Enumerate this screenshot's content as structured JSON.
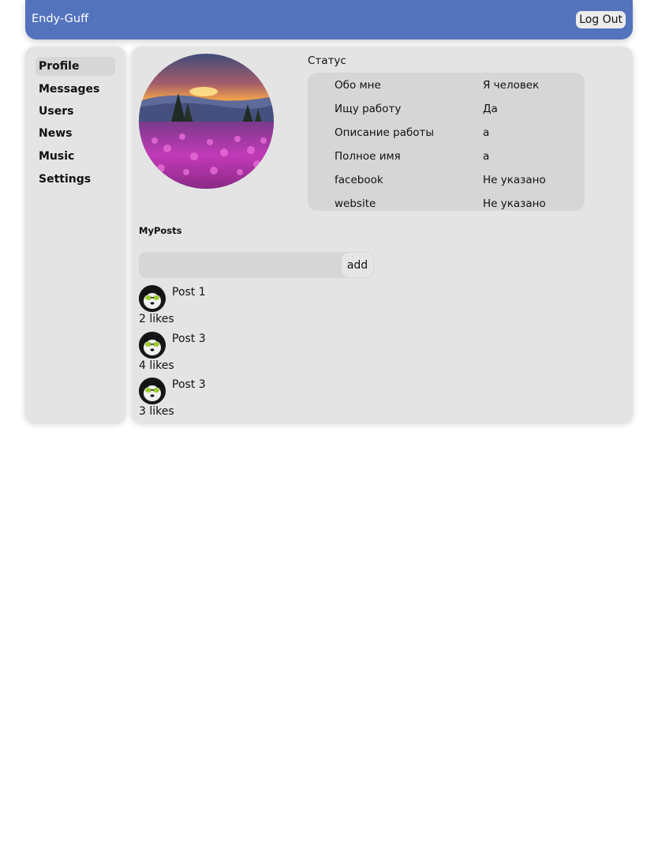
{
  "header": {
    "brand": "Endy-Guff",
    "logout_label": "Log Out",
    "color": "#5373bd"
  },
  "sidebar": {
    "items": [
      {
        "label": "Profile",
        "active": true
      },
      {
        "label": "Messages"
      },
      {
        "label": "Users"
      },
      {
        "label": "News"
      },
      {
        "label": "Music"
      },
      {
        "label": "Settings"
      }
    ]
  },
  "profile": {
    "avatar_icon": "landscape-avatar",
    "status": "Статус",
    "info": [
      {
        "label": "Обо мне",
        "value": "Я человек"
      },
      {
        "label": "Ищу работу",
        "value": "Да"
      },
      {
        "label": "Описание работы",
        "value": "a"
      },
      {
        "label": "Полное имя",
        "value": "a"
      },
      {
        "label": "facebook",
        "value": "Не указано"
      },
      {
        "label": "website",
        "value": "Не указано"
      }
    ]
  },
  "posts": {
    "title": "MyPosts",
    "input_value": "",
    "add_label": "add",
    "items": [
      {
        "text": "Post 1",
        "likes": "2 likes"
      },
      {
        "text": "Post 3",
        "likes": "4 likes"
      },
      {
        "text": "Post 3",
        "likes": "3 likes"
      }
    ],
    "avatar_icon": "panda-avatar"
  }
}
